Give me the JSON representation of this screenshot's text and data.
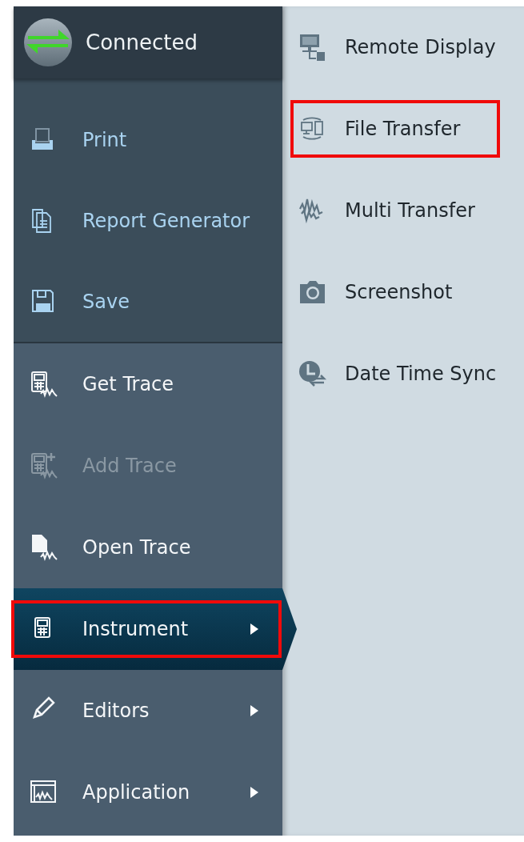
{
  "header": {
    "status": "Connected"
  },
  "sidebar": {
    "sections": [
      {
        "kind": "file",
        "items": [
          {
            "label": "Print",
            "kind": "print",
            "disabled": false,
            "selected": false,
            "highlighted": false,
            "has_submenu": false
          },
          {
            "label": "Report Generator",
            "kind": "report",
            "disabled": false,
            "selected": false,
            "highlighted": false,
            "has_submenu": false
          },
          {
            "label": "Save",
            "kind": "save",
            "disabled": false,
            "selected": false,
            "highlighted": false,
            "has_submenu": false
          }
        ]
      },
      {
        "kind": "trace",
        "items": [
          {
            "label": "Get Trace",
            "kind": "get-trace",
            "disabled": false,
            "selected": false,
            "highlighted": false,
            "has_submenu": false
          },
          {
            "label": "Add Trace",
            "kind": "add-trace",
            "disabled": true,
            "selected": false,
            "highlighted": false,
            "has_submenu": false
          },
          {
            "label": "Open Trace",
            "kind": "open-trace",
            "disabled": false,
            "selected": false,
            "highlighted": false,
            "has_submenu": false
          },
          {
            "label": "Instrument",
            "kind": "instrument",
            "disabled": false,
            "selected": true,
            "highlighted": true,
            "has_submenu": true
          },
          {
            "label": "Editors",
            "kind": "editors",
            "disabled": false,
            "selected": false,
            "highlighted": false,
            "has_submenu": true
          },
          {
            "label": "Application",
            "kind": "application",
            "disabled": false,
            "selected": false,
            "highlighted": false,
            "has_submenu": true
          }
        ]
      }
    ]
  },
  "submenu": {
    "items": [
      {
        "label": "Remote Display",
        "kind": "remote-display",
        "highlighted": false
      },
      {
        "label": "File Transfer",
        "kind": "file-transfer",
        "highlighted": true
      },
      {
        "label": "Multi Transfer",
        "kind": "multi-transfer",
        "highlighted": false
      },
      {
        "label": "Screenshot",
        "kind": "screenshot",
        "highlighted": false
      },
      {
        "label": "Date Time Sync",
        "kind": "date-time-sync",
        "highlighted": false
      }
    ]
  }
}
